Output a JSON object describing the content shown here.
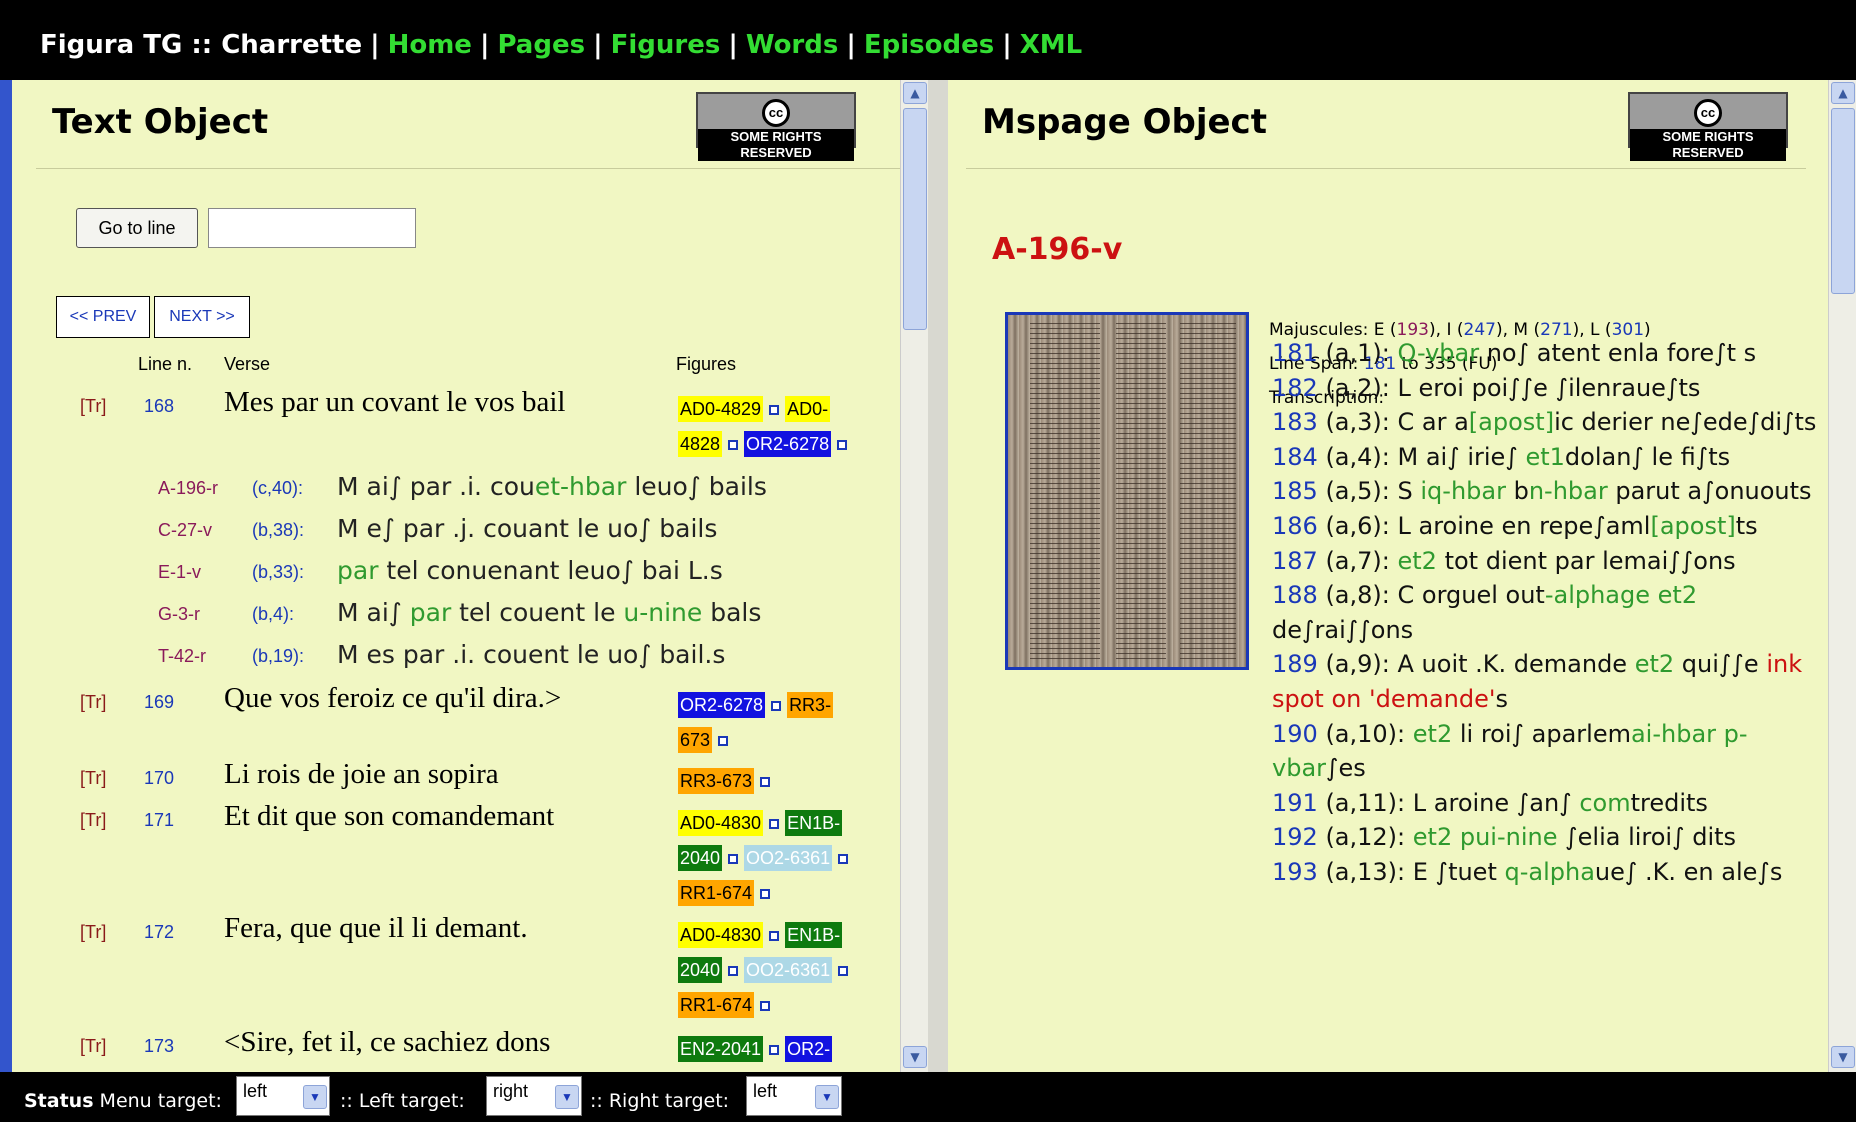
{
  "nav": {
    "title": "Figura TG :: Charrette",
    "sep": "|",
    "links": [
      "Home",
      "Pages",
      "Figures",
      "Words",
      "Episodes",
      "XML"
    ]
  },
  "left": {
    "title": "Text Object",
    "cc_badge": "SOME RIGHTS RESERVED",
    "cc_symbol": "cc",
    "goto_label": "Go to line",
    "goto_value": "",
    "prev_label": "<< PREV",
    "next_label": "NEXT >>",
    "headers": {
      "line": "Line n.",
      "verse": "Verse",
      "figures": "Figures"
    },
    "tr_label": "[Tr]",
    "rows": [
      {
        "line": "168",
        "verse": "Mes par un covant le vos bail"
      },
      {
        "line": "169",
        "verse": "Que vos feroiz ce qu'il dira.>"
      },
      {
        "line": "170",
        "verse": "Li rois de joie an sopira"
      },
      {
        "line": "171",
        "verse": "Et dit que son comandemant"
      },
      {
        "line": "172",
        "verse": "Fera, que que il li demant."
      },
      {
        "line": "173",
        "verse": "<Sire, fet il, ce sachiez dons"
      }
    ],
    "figs": {
      "r168": [
        "AD0-4829",
        "AD0-",
        "4828",
        "OR2-6278"
      ],
      "r169": [
        "OR2-6278",
        "RR3-",
        "673"
      ],
      "r170": [
        "RR3-673"
      ],
      "r171": [
        "AD0-4830",
        "EN1B-",
        "2040",
        "OO2-6361",
        "RR1-674"
      ],
      "r172": [
        "AD0-4830",
        "EN1B-",
        "2040",
        "OO2-6361",
        "RR1-674"
      ],
      "r173": [
        "EN2-2041",
        "OR2-"
      ]
    },
    "witnesses": [
      {
        "id": "A-196-r",
        "pos": "(c,40):",
        "a": "M ai∫ par .i. cou",
        "b": "et-hbar",
        "c": " leuo∫ bails"
      },
      {
        "id": "C-27-v",
        "pos": "(b,38):",
        "a": "M e∫ par .j. couant le uo∫ bails",
        "b": "",
        "c": ""
      },
      {
        "id": "E-1-v",
        "pos": "(b,33):",
        "a": "",
        "b": "par",
        "c": " tel conuenant leuo∫ bai L.s"
      },
      {
        "id": "G-3-r",
        "pos": "(b,4):",
        "a": "M ai∫ ",
        "b": "par",
        "c": " tel couent le ",
        "d": "u-nine",
        "e": " bals"
      },
      {
        "id": "T-42-r",
        "pos": "(b,19):",
        "a": "M es par .i. couent le uo∫ bail.s",
        "b": "",
        "c": ""
      }
    ]
  },
  "right": {
    "title": "Mspage Object",
    "cc_badge": "SOME RIGHTS RESERVED",
    "cc_symbol": "cc",
    "page_id": "A-196-v",
    "maj_label": "Majuscules: ",
    "maj": [
      {
        "letter": "E",
        "n": "193"
      },
      {
        "letter": "I",
        "n": "247"
      },
      {
        "letter": "M",
        "n": "271"
      },
      {
        "letter": "L",
        "n": "301"
      }
    ],
    "span_label": "Line Span: ",
    "span_from": "181",
    "span_to": " to 335 (FU)",
    "transcription_label": "Transcription:",
    "lines": [
      {
        "n": "181",
        "pos": " (a,1): ",
        "segs": [
          {
            "t": "Q-vbar",
            "g": true
          },
          {
            "t": " no∫ atent enla fore∫t s"
          }
        ]
      },
      {
        "n": "182",
        "pos": " (a,2): ",
        "segs": [
          {
            "t": "L eroi poi∫∫e ∫ilenraue∫ts"
          }
        ]
      },
      {
        "n": "183",
        "pos": " (a,3): ",
        "segs": [
          {
            "t": "C ar a"
          },
          {
            "t": "[apost]",
            "g": true
          },
          {
            "t": "ic derier ne∫ede∫di∫ts"
          }
        ]
      },
      {
        "n": "184",
        "pos": " (a,4): ",
        "segs": [
          {
            "t": "M ai∫ irie∫ "
          },
          {
            "t": "et1",
            "g": true
          },
          {
            "t": "dolan∫ le fi∫ts"
          }
        ]
      },
      {
        "n": "185",
        "pos": " (a,5): ",
        "segs": [
          {
            "t": "S "
          },
          {
            "t": "iq-hbar",
            "g": true
          },
          {
            "t": " b"
          },
          {
            "t": "n-hbar",
            "g": true
          },
          {
            "t": " parut a∫onuouts"
          }
        ]
      },
      {
        "n": "186",
        "pos": " (a,6): ",
        "segs": [
          {
            "t": "L aroine en repe∫aml"
          },
          {
            "t": "[apost]",
            "g": true
          },
          {
            "t": "ts"
          }
        ]
      },
      {
        "n": "187",
        "pos": " (a,7): ",
        "segs": [
          {
            "t": "et2",
            "g": true
          },
          {
            "t": " tot dient par lemai∫∫ons"
          }
        ]
      },
      {
        "n": "188",
        "pos": " (a,8): ",
        "segs": [
          {
            "t": "C orguel out"
          },
          {
            "t": "-alphage",
            "g": true
          },
          {
            "t": " "
          },
          {
            "t": "et2",
            "g": true
          },
          {
            "t": " de∫rai∫∫ons"
          }
        ]
      },
      {
        "n": "189",
        "pos": " (a,9): ",
        "segs": [
          {
            "t": "A uoit .K. demande "
          },
          {
            "t": "et2",
            "g": true
          },
          {
            "t": " qui∫∫e "
          },
          {
            "t": "ink spot on 'demande'",
            "r": true
          },
          {
            "t": "s"
          }
        ]
      },
      {
        "n": "190",
        "pos": " (a,10): ",
        "segs": [
          {
            "t": "et2",
            "g": true
          },
          {
            "t": " li roi∫ aparlem"
          },
          {
            "t": "ai-hbar p-vbar",
            "g": true
          },
          {
            "t": "∫es"
          }
        ]
      },
      {
        "n": "191",
        "pos": " (a,11): ",
        "segs": [
          {
            "t": "L aroine ∫an∫ "
          },
          {
            "t": "com",
            "g": true
          },
          {
            "t": "tredits"
          }
        ]
      },
      {
        "n": "192",
        "pos": " (a,12): ",
        "segs": [
          {
            "t": "et2",
            "g": true
          },
          {
            "t": " "
          },
          {
            "t": "pui-nine",
            "g": true
          },
          {
            "t": " ∫elia liroi∫ dits"
          }
        ]
      },
      {
        "n": "193",
        "pos": " (a,13): ",
        "segs": [
          {
            "t": "E ∫tuet "
          },
          {
            "t": "q-alpha",
            "g": true
          },
          {
            "t": "ue∫ .K. en ale∫s"
          }
        ]
      }
    ]
  },
  "status": {
    "label": "Status",
    "menu_label": " Menu target:",
    "menu_value": "left",
    "left_label": ":: Left target:",
    "left_value": "right",
    "right_label": ":: Right target:",
    "right_value": "left"
  },
  "icons": {
    "scroll_up": "▲",
    "scroll_down": "▼",
    "select_arrow": "▼"
  },
  "colors": {
    "pane_bg": "#f1f7c3",
    "nav_link": "#33dd33",
    "link_blue": "#1a38b8",
    "red": "#cc1111",
    "fig_yellow": "#ffff00",
    "fig_blue": "#1212e0",
    "fig_orange": "#ffa500",
    "fig_green": "#0e7a0e",
    "fig_lightblue": "#add8e6"
  }
}
